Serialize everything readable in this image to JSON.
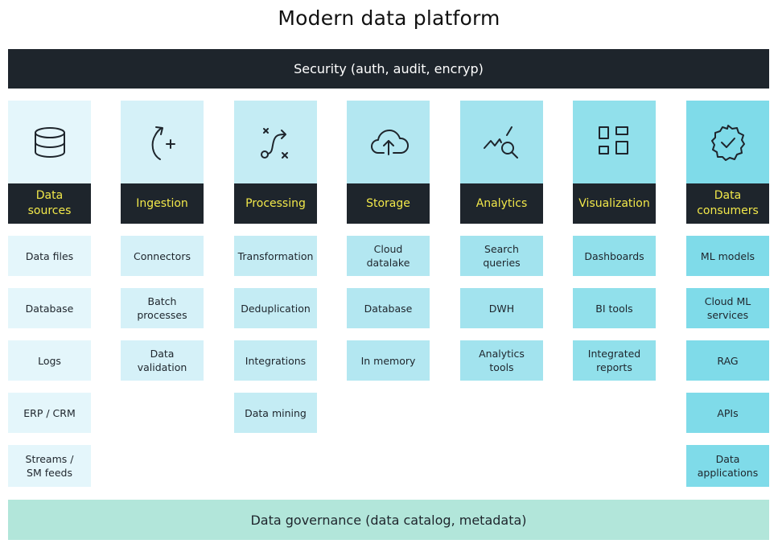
{
  "title": "Modern data platform",
  "security_bar": "Security (auth, audit, encryp)",
  "governance_bar": "Data governance (data catalog, metadata)",
  "colors": {
    "dark": "#1e252c",
    "label_text": "#f2e84a",
    "governance": "#b2e6da"
  },
  "columns": [
    {
      "id": "data-sources",
      "label": "Data\nsources",
      "icon": "database-icon",
      "color": "#e4f6fb",
      "items": [
        "Data files",
        "Database",
        "Logs",
        "ERP / CRM",
        "Streams /\nSM feeds"
      ]
    },
    {
      "id": "ingestion",
      "label": "Ingestion",
      "icon": "ingestion-arrow-plus-icon",
      "color": "#d5f1f8",
      "items": [
        "Connectors",
        "Batch\nprocesses",
        "Data\nvalidation"
      ]
    },
    {
      "id": "processing",
      "label": "Processing",
      "icon": "processing-path-icon",
      "color": "#c4ecf4",
      "items": [
        "Transformation",
        "Deduplication",
        "Integrations",
        "Data mining"
      ]
    },
    {
      "id": "storage",
      "label": "Storage",
      "icon": "cloud-upload-icon",
      "color": "#b3e7f1",
      "items": [
        "Cloud\ndatalake",
        "Database",
        "In memory"
      ]
    },
    {
      "id": "analytics",
      "label": "Analytics",
      "icon": "analytics-search-icon",
      "color": "#a2e3ee",
      "items": [
        "Search\nqueries",
        "DWH",
        "Analytics\ntools"
      ]
    },
    {
      "id": "visualization",
      "label": "Visualization",
      "icon": "dashboard-grid-icon",
      "color": "#91e0eb",
      "items": [
        "Dashboards",
        "BI tools",
        "Integrated\nreports"
      ]
    },
    {
      "id": "data-consumers",
      "label": "Data\nconsumers",
      "icon": "verified-badge-icon",
      "color": "#7fdbe9",
      "items": [
        "ML models",
        "Cloud ML\nservices",
        "RAG",
        "APIs",
        "Data\napplications"
      ]
    }
  ]
}
